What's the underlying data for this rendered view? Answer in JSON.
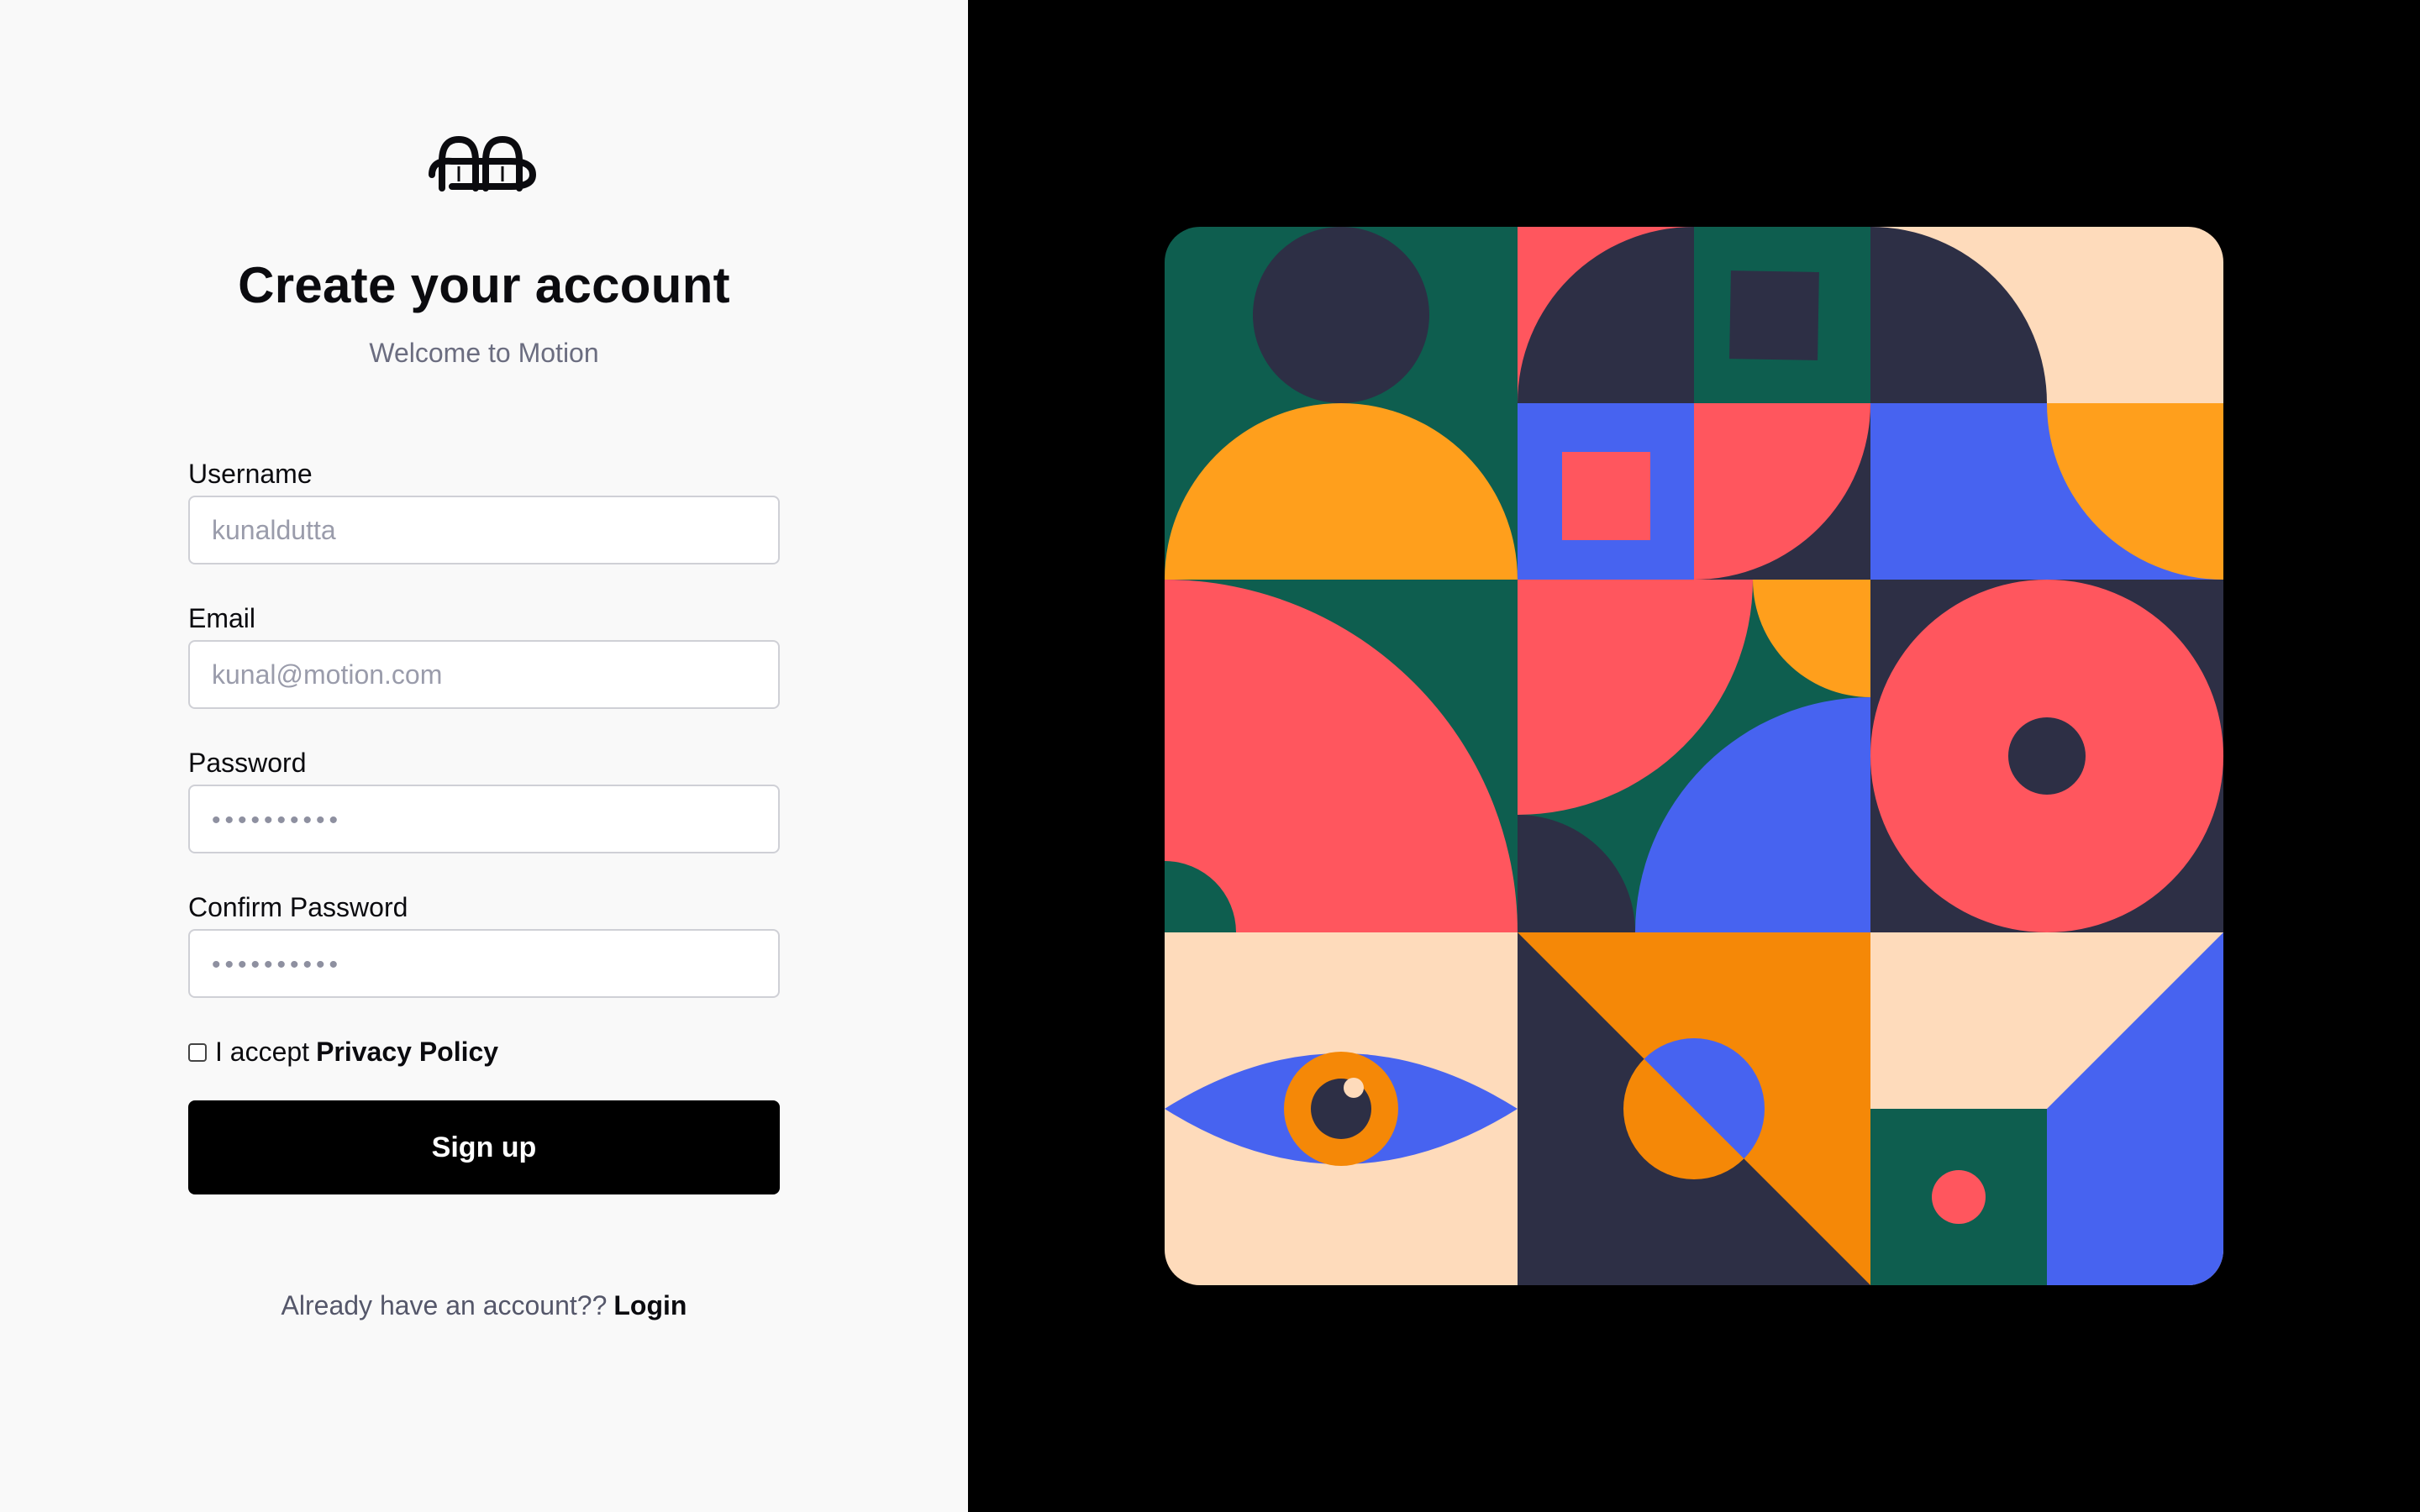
{
  "brand": {
    "logo_icon": "motion-logo-icon"
  },
  "header": {
    "title": "Create your account",
    "subtitle": "Welcome to Motion"
  },
  "form": {
    "username": {
      "label": "Username",
      "placeholder": "kunaldutta"
    },
    "email": {
      "label": "Email",
      "placeholder": "kunal@motion.com"
    },
    "password": {
      "label": "Password",
      "placeholder": "••••••••••"
    },
    "confirm_password": {
      "label": "Confirm Password",
      "placeholder": "••••••••••"
    },
    "accept": {
      "prefix": "I accept",
      "link": "Privacy Policy",
      "checked": false
    },
    "submit_label": "Sign up"
  },
  "footer": {
    "prompt": "Already have an account??",
    "login_label": "Login"
  },
  "colors": {
    "panel_bg": "#f9f9f9",
    "dark": "#2d2f45",
    "green": "#0e5e4f",
    "red": "#ff565e",
    "orange": "#ff9f1c",
    "deep_orange": "#f58807",
    "blue": "#4763f0",
    "peach": "#fedbbb"
  }
}
